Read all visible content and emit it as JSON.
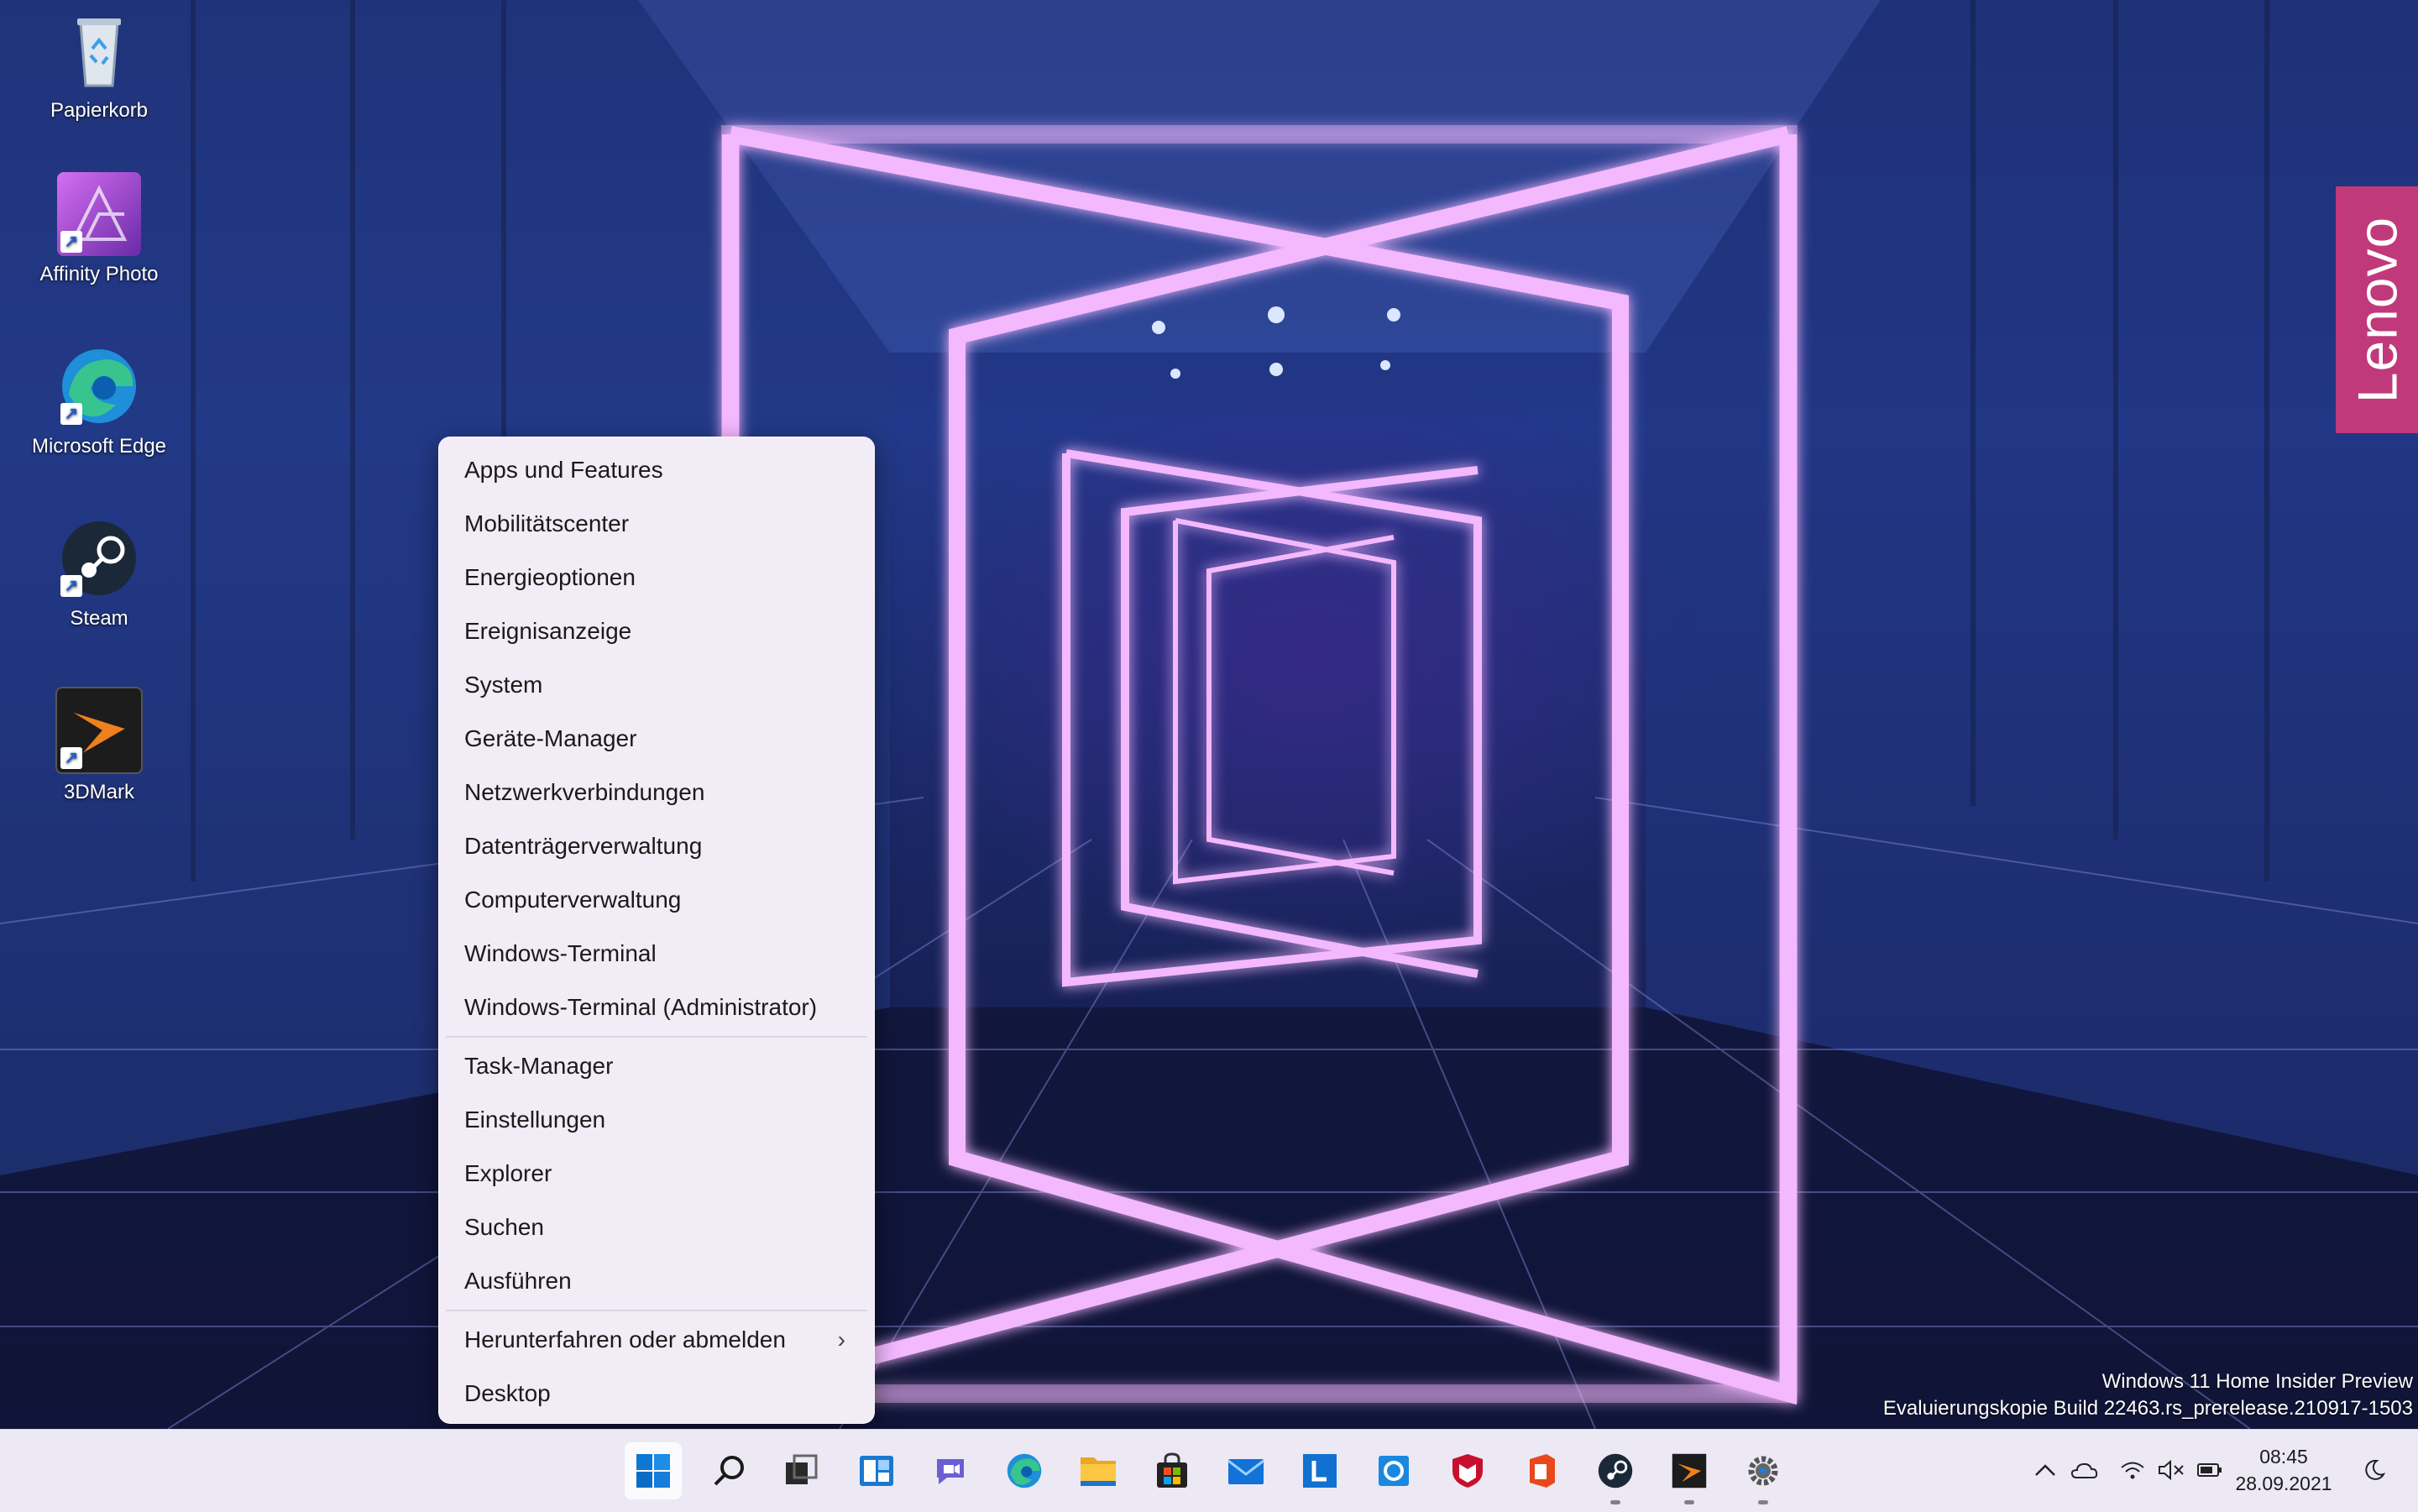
{
  "desktop": {
    "icons": [
      {
        "label": "Papierkorb"
      },
      {
        "label": "Affinity Photo"
      },
      {
        "label": "Microsoft Edge"
      },
      {
        "label": "Steam"
      },
      {
        "label": "3DMark"
      }
    ],
    "brand": "Lenovo",
    "watermark": {
      "line1": "Windows 11 Home Insider Preview",
      "line2": "Evaluierungskopie Build 22463.rs_prerelease.210917-1503"
    }
  },
  "context_menu": {
    "group1": [
      "Apps und Features",
      "Mobilitätscenter",
      "Energieoptionen",
      "Ereignisanzeige",
      "System",
      "Geräte-Manager",
      "Netzwerkverbindungen",
      "Datenträgerverwaltung",
      "Computerverwaltung",
      "Windows-Terminal",
      "Windows-Terminal (Administrator)"
    ],
    "group2": [
      "Task-Manager",
      "Einstellungen",
      "Explorer",
      "Suchen",
      "Ausführen"
    ],
    "group3": [
      "Herunterfahren oder abmelden",
      "Desktop"
    ],
    "submenu_icon": "chevron-right-icon"
  },
  "taskbar": {
    "apps": [
      "start-icon",
      "search-icon",
      "task-view-icon",
      "widgets-icon",
      "teams-chat-icon",
      "edge-icon",
      "file-explorer-icon",
      "store-icon",
      "mail-icon",
      "lenovo-vantage-icon",
      "cortana-icon",
      "mcafee-icon",
      "office-icon",
      "steam-icon",
      "3dmark-icon",
      "settings-icon"
    ],
    "tray": [
      "chevron-up-icon",
      "onedrive-icon",
      "wifi-icon",
      "volume-muted-icon",
      "battery-icon"
    ],
    "clock": {
      "time": "08:45",
      "date": "28.09.2021"
    }
  },
  "colors": {
    "accent": "#0067c0",
    "lenovo_brand": "#c0397a",
    "neon": "#e48cff"
  }
}
